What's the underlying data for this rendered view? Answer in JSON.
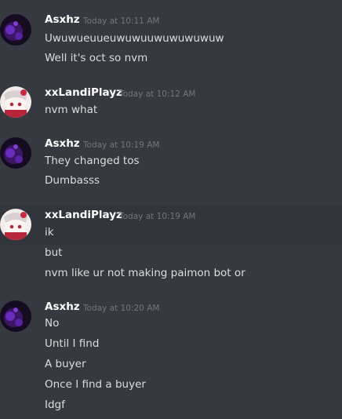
{
  "messages": [
    {
      "author": "Asxhz",
      "timestamp": "Today at 10:11 AM",
      "avatar_icon": "purple-dark-avatar-icon",
      "lines": [
        "Uwuwueuueuwuwuuwuwuwuwuw",
        "Well it's oct so nvm"
      ]
    },
    {
      "author": "xxLandiPlayz",
      "timestamp": "Today at 10:12 AM",
      "avatar_icon": "anime-girl-avatar-icon",
      "lines": [
        "nvm what"
      ]
    },
    {
      "author": "Asxhz",
      "timestamp": "Today at 10:19 AM",
      "avatar_icon": "purple-dark-avatar-icon",
      "lines": [
        "They changed tos",
        "Dumbasss"
      ]
    },
    {
      "author": "xxLandiPlayz",
      "timestamp": "Today at 10:19 AM",
      "avatar_icon": "anime-girl-avatar-icon",
      "lines": [
        "ik",
        "but",
        "nvm like ur not making paimon bot or"
      ]
    },
    {
      "author": "Asxhz",
      "timestamp": "Today at 10:20 AM",
      "avatar_icon": "purple-dark-avatar-icon",
      "lines": [
        "No",
        "Until I find",
        "A buyer",
        "Once I find a buyer",
        "Idgf"
      ]
    }
  ],
  "colors": {
    "background": "#36393f",
    "username": "#ffffff",
    "timestamp": "#72767d",
    "text": "#dcddde",
    "hover": "#32353b"
  }
}
